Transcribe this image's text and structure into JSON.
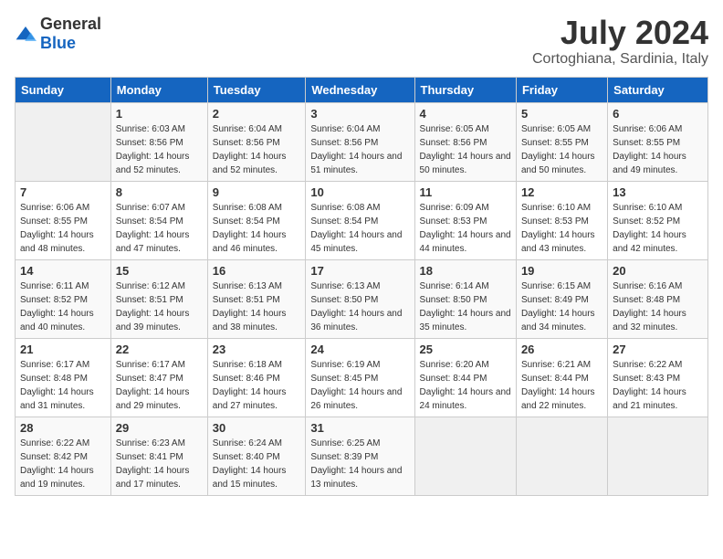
{
  "logo": {
    "general": "General",
    "blue": "Blue"
  },
  "title": "July 2024",
  "subtitle": "Cortoghiana, Sardinia, Italy",
  "days_header": [
    "Sunday",
    "Monday",
    "Tuesday",
    "Wednesday",
    "Thursday",
    "Friday",
    "Saturday"
  ],
  "weeks": [
    [
      {
        "num": "",
        "sunrise": "",
        "sunset": "",
        "daylight": ""
      },
      {
        "num": "1",
        "sunrise": "Sunrise: 6:03 AM",
        "sunset": "Sunset: 8:56 PM",
        "daylight": "Daylight: 14 hours and 52 minutes."
      },
      {
        "num": "2",
        "sunrise": "Sunrise: 6:04 AM",
        "sunset": "Sunset: 8:56 PM",
        "daylight": "Daylight: 14 hours and 52 minutes."
      },
      {
        "num": "3",
        "sunrise": "Sunrise: 6:04 AM",
        "sunset": "Sunset: 8:56 PM",
        "daylight": "Daylight: 14 hours and 51 minutes."
      },
      {
        "num": "4",
        "sunrise": "Sunrise: 6:05 AM",
        "sunset": "Sunset: 8:56 PM",
        "daylight": "Daylight: 14 hours and 50 minutes."
      },
      {
        "num": "5",
        "sunrise": "Sunrise: 6:05 AM",
        "sunset": "Sunset: 8:55 PM",
        "daylight": "Daylight: 14 hours and 50 minutes."
      },
      {
        "num": "6",
        "sunrise": "Sunrise: 6:06 AM",
        "sunset": "Sunset: 8:55 PM",
        "daylight": "Daylight: 14 hours and 49 minutes."
      }
    ],
    [
      {
        "num": "7",
        "sunrise": "Sunrise: 6:06 AM",
        "sunset": "Sunset: 8:55 PM",
        "daylight": "Daylight: 14 hours and 48 minutes."
      },
      {
        "num": "8",
        "sunrise": "Sunrise: 6:07 AM",
        "sunset": "Sunset: 8:54 PM",
        "daylight": "Daylight: 14 hours and 47 minutes."
      },
      {
        "num": "9",
        "sunrise": "Sunrise: 6:08 AM",
        "sunset": "Sunset: 8:54 PM",
        "daylight": "Daylight: 14 hours and 46 minutes."
      },
      {
        "num": "10",
        "sunrise": "Sunrise: 6:08 AM",
        "sunset": "Sunset: 8:54 PM",
        "daylight": "Daylight: 14 hours and 45 minutes."
      },
      {
        "num": "11",
        "sunrise": "Sunrise: 6:09 AM",
        "sunset": "Sunset: 8:53 PM",
        "daylight": "Daylight: 14 hours and 44 minutes."
      },
      {
        "num": "12",
        "sunrise": "Sunrise: 6:10 AM",
        "sunset": "Sunset: 8:53 PM",
        "daylight": "Daylight: 14 hours and 43 minutes."
      },
      {
        "num": "13",
        "sunrise": "Sunrise: 6:10 AM",
        "sunset": "Sunset: 8:52 PM",
        "daylight": "Daylight: 14 hours and 42 minutes."
      }
    ],
    [
      {
        "num": "14",
        "sunrise": "Sunrise: 6:11 AM",
        "sunset": "Sunset: 8:52 PM",
        "daylight": "Daylight: 14 hours and 40 minutes."
      },
      {
        "num": "15",
        "sunrise": "Sunrise: 6:12 AM",
        "sunset": "Sunset: 8:51 PM",
        "daylight": "Daylight: 14 hours and 39 minutes."
      },
      {
        "num": "16",
        "sunrise": "Sunrise: 6:13 AM",
        "sunset": "Sunset: 8:51 PM",
        "daylight": "Daylight: 14 hours and 38 minutes."
      },
      {
        "num": "17",
        "sunrise": "Sunrise: 6:13 AM",
        "sunset": "Sunset: 8:50 PM",
        "daylight": "Daylight: 14 hours and 36 minutes."
      },
      {
        "num": "18",
        "sunrise": "Sunrise: 6:14 AM",
        "sunset": "Sunset: 8:50 PM",
        "daylight": "Daylight: 14 hours and 35 minutes."
      },
      {
        "num": "19",
        "sunrise": "Sunrise: 6:15 AM",
        "sunset": "Sunset: 8:49 PM",
        "daylight": "Daylight: 14 hours and 34 minutes."
      },
      {
        "num": "20",
        "sunrise": "Sunrise: 6:16 AM",
        "sunset": "Sunset: 8:48 PM",
        "daylight": "Daylight: 14 hours and 32 minutes."
      }
    ],
    [
      {
        "num": "21",
        "sunrise": "Sunrise: 6:17 AM",
        "sunset": "Sunset: 8:48 PM",
        "daylight": "Daylight: 14 hours and 31 minutes."
      },
      {
        "num": "22",
        "sunrise": "Sunrise: 6:17 AM",
        "sunset": "Sunset: 8:47 PM",
        "daylight": "Daylight: 14 hours and 29 minutes."
      },
      {
        "num": "23",
        "sunrise": "Sunrise: 6:18 AM",
        "sunset": "Sunset: 8:46 PM",
        "daylight": "Daylight: 14 hours and 27 minutes."
      },
      {
        "num": "24",
        "sunrise": "Sunrise: 6:19 AM",
        "sunset": "Sunset: 8:45 PM",
        "daylight": "Daylight: 14 hours and 26 minutes."
      },
      {
        "num": "25",
        "sunrise": "Sunrise: 6:20 AM",
        "sunset": "Sunset: 8:44 PM",
        "daylight": "Daylight: 14 hours and 24 minutes."
      },
      {
        "num": "26",
        "sunrise": "Sunrise: 6:21 AM",
        "sunset": "Sunset: 8:44 PM",
        "daylight": "Daylight: 14 hours and 22 minutes."
      },
      {
        "num": "27",
        "sunrise": "Sunrise: 6:22 AM",
        "sunset": "Sunset: 8:43 PM",
        "daylight": "Daylight: 14 hours and 21 minutes."
      }
    ],
    [
      {
        "num": "28",
        "sunrise": "Sunrise: 6:22 AM",
        "sunset": "Sunset: 8:42 PM",
        "daylight": "Daylight: 14 hours and 19 minutes."
      },
      {
        "num": "29",
        "sunrise": "Sunrise: 6:23 AM",
        "sunset": "Sunset: 8:41 PM",
        "daylight": "Daylight: 14 hours and 17 minutes."
      },
      {
        "num": "30",
        "sunrise": "Sunrise: 6:24 AM",
        "sunset": "Sunset: 8:40 PM",
        "daylight": "Daylight: 14 hours and 15 minutes."
      },
      {
        "num": "31",
        "sunrise": "Sunrise: 6:25 AM",
        "sunset": "Sunset: 8:39 PM",
        "daylight": "Daylight: 14 hours and 13 minutes."
      },
      {
        "num": "",
        "sunrise": "",
        "sunset": "",
        "daylight": ""
      },
      {
        "num": "",
        "sunrise": "",
        "sunset": "",
        "daylight": ""
      },
      {
        "num": "",
        "sunrise": "",
        "sunset": "",
        "daylight": ""
      }
    ]
  ]
}
